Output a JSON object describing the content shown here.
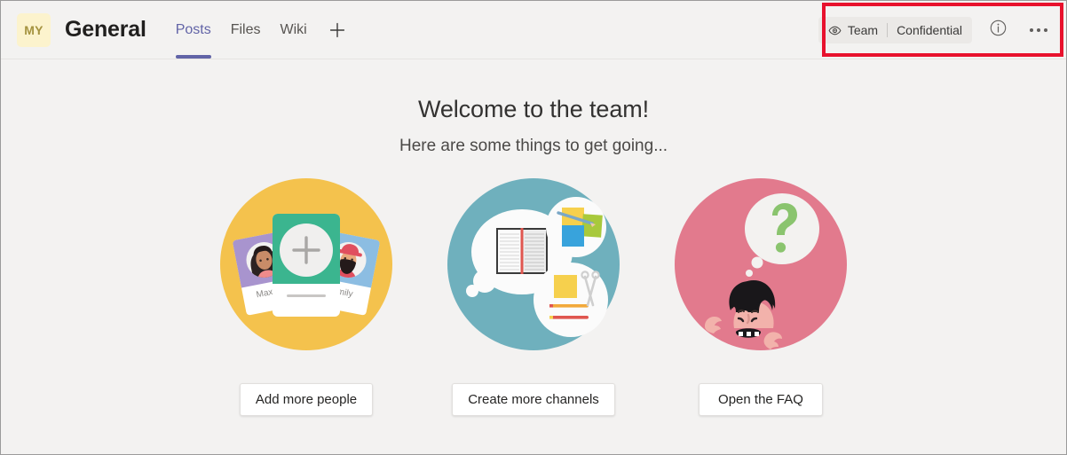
{
  "header": {
    "team_avatar_initials": "MY",
    "channel_name": "General",
    "tabs": [
      {
        "label": "Posts",
        "active": true
      },
      {
        "label": "Files",
        "active": false
      },
      {
        "label": "Wiki",
        "active": false
      }
    ],
    "add_tab_label": "+",
    "sensitivity": {
      "eye_icon": "eye-icon",
      "scope": "Team",
      "label": "Confidential"
    },
    "info_icon": "info-icon",
    "more_options_icon": "more-options-icon"
  },
  "annotation": {
    "color": "#e8112d"
  },
  "main": {
    "title": "Welcome to the team!",
    "subtitle": "Here are some things to get going...",
    "cards": [
      {
        "illustration": "people-cards-illustration",
        "circle_color": "#f4c24d",
        "names": {
          "left": "Maxine",
          "right": "ly"
        },
        "button_label": "Add more people"
      },
      {
        "illustration": "channels-notebook-illustration",
        "circle_color": "#6fb0bd",
        "button_label": "Create more channels"
      },
      {
        "illustration": "faq-question-illustration",
        "circle_color": "#e27a8d",
        "button_label": "Open the FAQ"
      }
    ]
  }
}
